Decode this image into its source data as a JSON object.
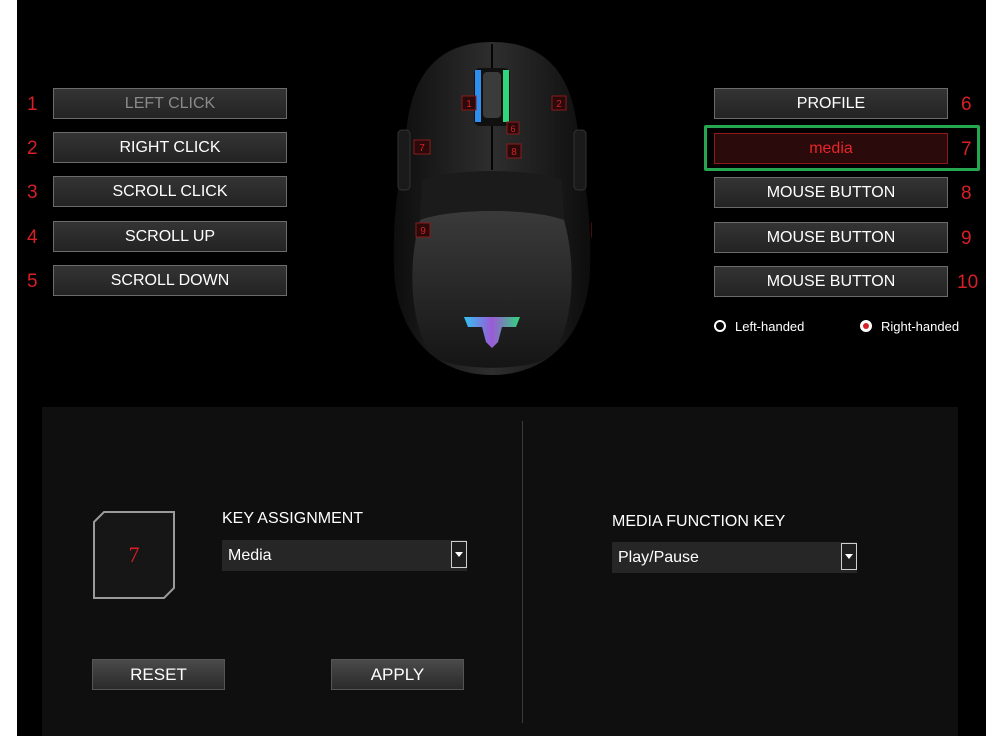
{
  "left_buttons": [
    {
      "num": "1",
      "label": "LEFT CLICK"
    },
    {
      "num": "2",
      "label": "RIGHT CLICK"
    },
    {
      "num": "3",
      "label": "SCROLL CLICK"
    },
    {
      "num": "4",
      "label": "SCROLL UP"
    },
    {
      "num": "5",
      "label": "SCROLL DOWN"
    }
  ],
  "right_buttons": [
    {
      "num": "6",
      "label": "PROFILE"
    },
    {
      "num": "7",
      "label": "media"
    },
    {
      "num": "8",
      "label": "MOUSE BUTTON"
    },
    {
      "num": "9",
      "label": "MOUSE BUTTON"
    },
    {
      "num": "10",
      "label": "MOUSE BUTTON"
    }
  ],
  "mouse_markers": [
    "1",
    "2",
    "6",
    "7",
    "8",
    "9",
    "10",
    "8"
  ],
  "handedness": {
    "left": "Left-handed",
    "right": "Right-handed",
    "selected": "right"
  },
  "panel": {
    "selected_key": "7",
    "key_assignment_label": "KEY ASSIGNMENT",
    "key_assignment_value": "Media",
    "media_function_label": "MEDIA FUNCTION KEY",
    "media_function_value": "Play/Pause",
    "reset_label": "RESET",
    "apply_label": "APPLY"
  },
  "colors": {
    "accent_red": "#d81f26",
    "selection_green": "#26a650",
    "logo_gradient": [
      "#31c4f3",
      "#9b59d6",
      "#2fd67c"
    ]
  }
}
